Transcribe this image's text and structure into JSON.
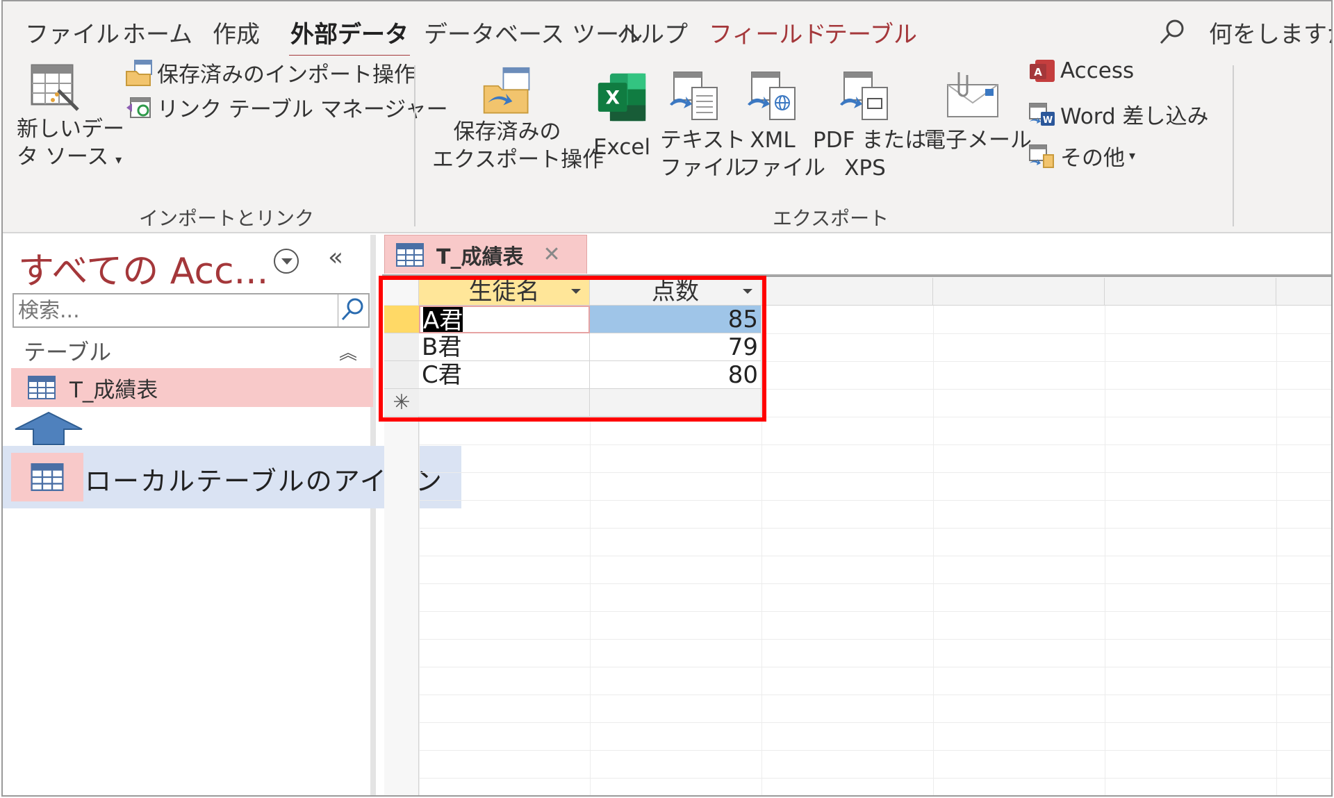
{
  "ribbon_tabs": {
    "file": "ファイル",
    "home": "ホーム",
    "create": "作成",
    "external_data": "外部データ",
    "database_tools": "データベース ツール",
    "help": "ヘルプ",
    "fields": "フィールド",
    "table": "テーブル",
    "tell_me": "何をしますか"
  },
  "import_group": {
    "label": "インポートとリンク",
    "new_source_line1": "新しいデー",
    "new_source_line2": "タ ソース",
    "saved_imports": "保存済みのインポート操作",
    "linked_table_manager": "リンク テーブル マネージャー"
  },
  "export_group": {
    "label": "エクスポート",
    "saved_exports_line1": "保存済みの",
    "saved_exports_line2": "エクスポート操作",
    "excel": "Excel",
    "text_line1": "テキスト",
    "text_line2": "ファイル",
    "xml_line1": "XML",
    "xml_line2": "ファイル",
    "pdf_line1": "PDF または",
    "pdf_line2": "XPS",
    "email": "電子メール",
    "access": "Access",
    "word_merge": "Word 差し込み",
    "more": "その他"
  },
  "nav": {
    "title": "すべての Acc...",
    "search_placeholder": "検索...",
    "group": "テーブル",
    "items": [
      {
        "label": "T_成績表"
      }
    ]
  },
  "annotation": {
    "text": "ローカルテーブルのアイコン"
  },
  "document": {
    "tab_title": "T_成績表",
    "columns": [
      "生徒名",
      "点数"
    ],
    "rows": [
      {
        "name": "A君",
        "score": "85"
      },
      {
        "name": "B君",
        "score": "79"
      },
      {
        "name": "C君",
        "score": "80"
      }
    ],
    "new_row_marker": "✳"
  },
  "colors": {
    "accent": "#a4373a",
    "highlight_pink": "#f8c9c9",
    "header_yellow": "#ffe699",
    "selection_blue": "#9fc5e8",
    "callout_blue": "#dae3f3",
    "annotation_red": "#ff0000"
  },
  "icons": {
    "new_data_source": "table-wand-icon",
    "saved_imports": "folder-import-icon",
    "linked_table_manager": "linked-table-icon",
    "saved_exports": "folder-export-icon",
    "excel": "excel-icon",
    "text_file": "text-export-icon",
    "xml_file": "xml-export-icon",
    "pdf": "pdf-export-icon",
    "email": "envelope-icon",
    "access": "access-icon",
    "word_merge": "word-merge-icon",
    "more": "more-export-icon",
    "search": "search-icon",
    "table": "table-icon"
  }
}
